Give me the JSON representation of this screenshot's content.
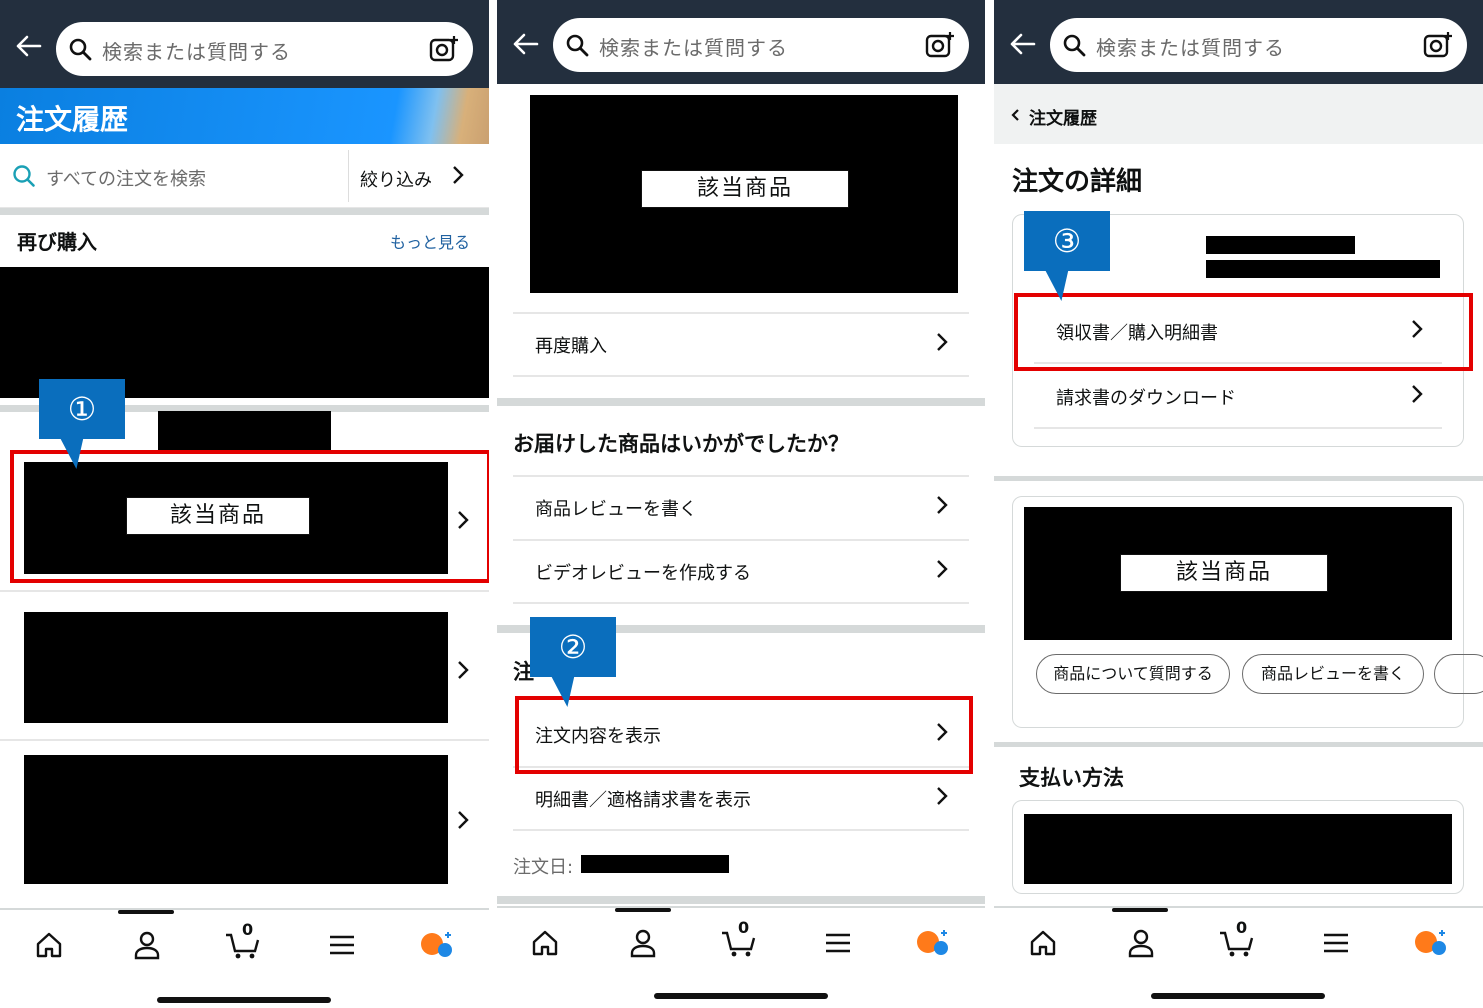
{
  "search": {
    "placeholder": "検索または質問する"
  },
  "panel1": {
    "title": "注文履歴",
    "order_search": "すべての注文を検索",
    "filter": "絞り込み",
    "buy_again": "再び購入",
    "see_more": "もっと見る",
    "item_label": "該当商品",
    "callout": "①"
  },
  "panel2": {
    "item_label": "該当商品",
    "buy_again_row": "再度購入",
    "feedback_heading": "お届けした商品はいかがでしたか？",
    "write_review": "商品レビューを書く",
    "video_review": "ビデオレビューを作成する",
    "section_partial": "注",
    "view_order": "注文内容を表示",
    "view_invoice": "明細書／適格請求書を表示",
    "order_date_label": "注文日:",
    "callout": "②"
  },
  "panel3": {
    "breadcrumb": "注文履歴",
    "heading": "注文の詳細",
    "receipt": "領収書／購入明細書",
    "invoice_download": "請求書のダウンロード",
    "item_label": "該当商品",
    "ask_question": "商品について質問する",
    "write_review": "商品レビューを書く",
    "payment_heading": "支払い方法",
    "callout": "③"
  },
  "nav": {
    "cart_count": "0"
  },
  "colors": {
    "header": "#232f3e",
    "title_bar": "#0d8ef0",
    "highlight": "#e30000",
    "callout": "#0a6ebd"
  }
}
